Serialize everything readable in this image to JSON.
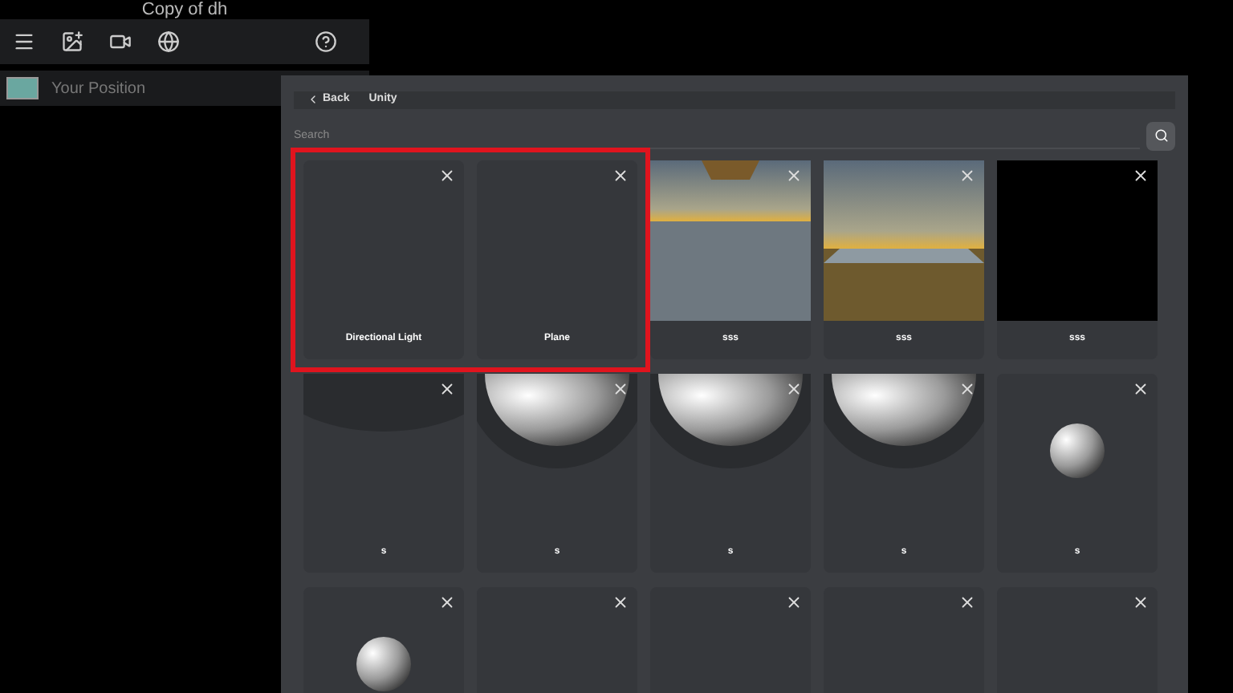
{
  "window": {
    "title": "Copy of dh"
  },
  "layers": [
    {
      "label": "Your Position",
      "selected": false
    }
  ],
  "dialog": {
    "back": "Back",
    "title": "Unity",
    "search": {
      "placeholder": "Search"
    },
    "framed_cards": [
      {
        "label": "Directional Light",
        "kind": "empty"
      },
      {
        "label": "Plane",
        "kind": "empty"
      }
    ],
    "cards": [
      {
        "label": "sss",
        "kind": "horizon"
      },
      {
        "label": "sss",
        "kind": "horizon-low"
      },
      {
        "label": "sss",
        "kind": "black"
      },
      {
        "label": "s",
        "kind": "dome"
      },
      {
        "label": "s",
        "kind": "sphere-large"
      },
      {
        "label": "s",
        "kind": "sphere-large"
      },
      {
        "label": "s",
        "kind": "sphere-large"
      },
      {
        "label": "s",
        "kind": "sphere-small"
      },
      {
        "kind": "sphere-small"
      },
      {
        "kind": "empty"
      },
      {
        "kind": "empty"
      },
      {
        "kind": "empty"
      },
      {
        "kind": "empty"
      }
    ]
  }
}
